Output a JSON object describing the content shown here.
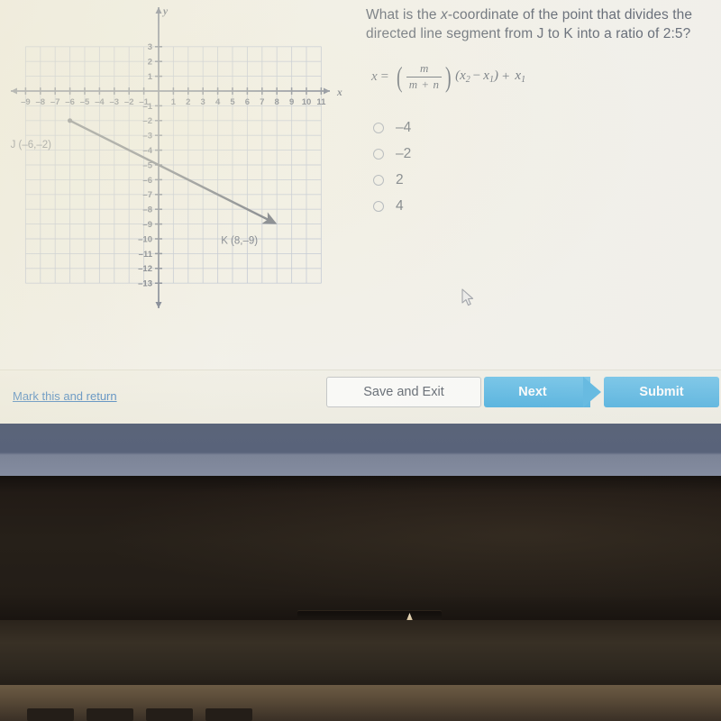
{
  "question": {
    "line1_a": "What is the ",
    "line1_italic": "x",
    "line1_b": "-coordinate of the point that divides the",
    "line2": "directed line segment from J to K into a ratio of 2:5?"
  },
  "formula": {
    "lhs": "x",
    "equals": "=",
    "numerator": "m",
    "denominator": "m + n",
    "open_paren": "(",
    "close_paren": ")",
    "factor_open": "(",
    "factor_x2": "x",
    "factor_x2_sub": "2",
    "minus": "−",
    "factor_x1": "x",
    "factor_x1_sub": "1",
    "factor_close": ")",
    "plus": "+",
    "tail_x1": "x",
    "tail_x1_sub": "1"
  },
  "choices": [
    {
      "id": "choice-a",
      "label": "–4",
      "selected": false
    },
    {
      "id": "choice-b",
      "label": "–2",
      "selected": false
    },
    {
      "id": "choice-c",
      "label": "2",
      "selected": false
    },
    {
      "id": "choice-d",
      "label": "4",
      "selected": false
    }
  ],
  "action_bar": {
    "mark_link": "Mark this and return",
    "save_exit": "Save and Exit",
    "next": "Next",
    "submit": "Submit"
  },
  "colors": {
    "accent_blue": "#2ca2da",
    "link_blue": "#2d72b8",
    "text": "#3a4352",
    "grid_line": "#a9b4cc",
    "axis": "#4a5570",
    "segment": "#3d4557",
    "screen_bg": "#f2f0e9"
  },
  "chart_data": {
    "type": "scatter",
    "title": "",
    "xlabel": "x",
    "ylabel": "y",
    "xlim": [
      -9,
      11
    ],
    "ylim": [
      -13,
      3
    ],
    "grid": true,
    "x_ticks": [
      -9,
      -8,
      -7,
      -6,
      -5,
      -4,
      -3,
      -2,
      -1,
      1,
      2,
      3,
      4,
      5,
      6,
      7,
      8,
      9,
      10,
      11
    ],
    "x_tick_labels": [
      "–9",
      "–8",
      "–7",
      "–6",
      "–5",
      "–4",
      "–3",
      "–2",
      "–1",
      "1",
      "2",
      "3",
      "4",
      "5",
      "6",
      "7",
      "8",
      "9",
      "10",
      "11"
    ],
    "y_ticks": [
      3,
      2,
      1,
      -1,
      -2,
      -3,
      -4,
      -5,
      -6,
      -7,
      -8,
      -9,
      -10,
      -11,
      -12,
      -13
    ],
    "y_tick_labels": [
      "3",
      "2",
      "1",
      "–1",
      "–2",
      "–3",
      "–4",
      "–5",
      "–6",
      "–7",
      "–8",
      "–9",
      "–10",
      "–11",
      "–12",
      "–13"
    ],
    "points": [
      {
        "name": "J",
        "x": -6,
        "y": -2,
        "label": "J (–6,–2)"
      },
      {
        "name": "K",
        "x": 8,
        "y": -9,
        "label": "K (8,–9)"
      }
    ],
    "segments": [
      {
        "from": "J",
        "to": "K",
        "arrow_at": "K",
        "x1": -6,
        "y1": -2,
        "x2": 8,
        "y2": -9
      }
    ]
  }
}
